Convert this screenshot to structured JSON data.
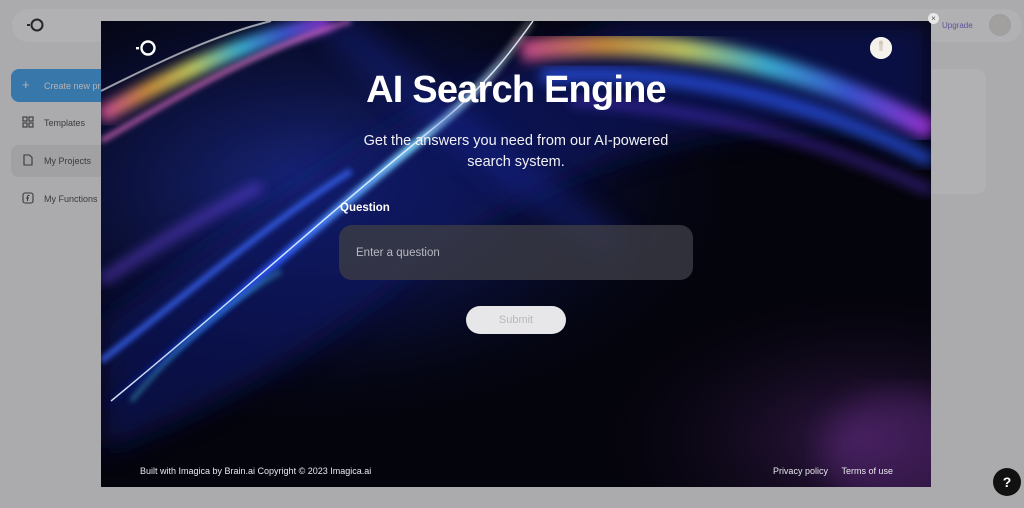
{
  "app": {
    "upgrade_label": "Upgrade",
    "sidebar": {
      "create_label": "Create new project",
      "items": [
        {
          "label": "Templates",
          "icon": "grid-icon"
        },
        {
          "label": "My Projects",
          "icon": "document-icon"
        },
        {
          "label": "My Functions",
          "icon": "function-icon"
        }
      ]
    }
  },
  "modal": {
    "close_glyph": "×",
    "title": "AI Search Engine",
    "subtitle": "Get the answers you need from our AI-powered search system.",
    "question_label": "Question",
    "question_placeholder": "Enter a question",
    "question_value": "",
    "submit_label": "Submit",
    "footer": {
      "credit": "Built with Imagica by Brain.ai Copyright © 2023 Imagica.ai",
      "privacy": "Privacy policy",
      "terms": "Terms of use"
    }
  },
  "help_glyph": "?",
  "colors": {
    "accent_blue": "#2f9cf0",
    "upgrade_purple": "#6d5cd6",
    "modal_bg": "#04040c"
  }
}
